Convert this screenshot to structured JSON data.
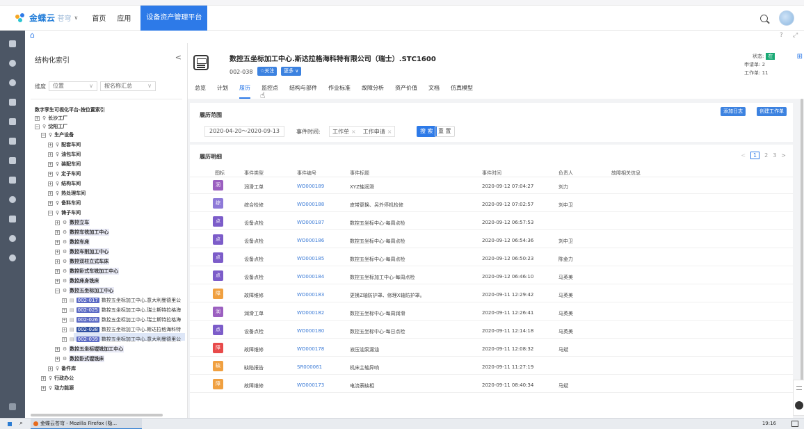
{
  "topbar": {
    "logo": "金蝶云",
    "logo_sub": "苍穹",
    "nav": [
      "首页",
      "应用"
    ],
    "active_nav": "设备资产管理平台"
  },
  "sidepanel": {
    "title": "结构化索引",
    "collapse": "<",
    "dim_label": "维度",
    "dim_value": "位置",
    "summary_value": "按名称汇总",
    "tree": [
      {
        "label": "数字孪生可视化平台-按位置索引"
      },
      {
        "label": "长沙工厂"
      },
      {
        "label": "沈阳工厂"
      },
      {
        "label": "生产设备"
      },
      {
        "label": "配套车间"
      },
      {
        "label": "油包车间"
      },
      {
        "label": "装配车间"
      },
      {
        "label": "定子车间"
      },
      {
        "label": "结构车间"
      },
      {
        "label": "热处理车间"
      },
      {
        "label": "备料车间"
      },
      {
        "label": "铸子车间"
      },
      {
        "label": "数控立车"
      },
      {
        "label": "数控车铣加工中心"
      },
      {
        "label": "数控车床"
      },
      {
        "label": "数控车削加工中心"
      },
      {
        "label": "数控双柱立式车床"
      },
      {
        "label": "数控卧式车铣加工中心"
      },
      {
        "label": "数控床身铣床"
      },
      {
        "label": "数控五坐标加工中心"
      },
      {
        "code": "002-017",
        "label": "数控五坐标加工中心.意大利曼德里公"
      },
      {
        "code": "002-025",
        "label": "数控五坐标加工中心.瑞士斯特拉格海"
      },
      {
        "code": "002-026",
        "label": "数控五坐标加工中心.瑞士斯特拉格海"
      },
      {
        "code": "002-038",
        "label": "数控五坐标加工中心.斯达拉格海科特"
      },
      {
        "code": "002-039",
        "label": "数控五坐标加工中心.意大利曼德里公"
      },
      {
        "label": "数控五坐标镗铣加工中心"
      },
      {
        "label": "数控卧式镗铣床"
      },
      {
        "label": "备件库"
      },
      {
        "label": "行政办公"
      },
      {
        "label": "动力能源"
      }
    ]
  },
  "asset": {
    "title": "数控五坐标加工中心.斯达拉格海科特有限公司（瑞士）.STC1600",
    "code": "002-038",
    "follow_btn": "☆关注",
    "more_btn": "更多 ∨",
    "status_label": "状态:",
    "status_value": "在",
    "request_label": "申请单:",
    "request_value": "2",
    "workorder_label": "工作单:",
    "workorder_value": "11",
    "tabs": [
      "总览",
      "计划",
      "履历",
      "监控点",
      "结构与部件",
      "作业标准",
      "故障分析",
      "资产价值",
      "文档",
      "仿真模型"
    ],
    "active_tab": "履历"
  },
  "scope": {
    "title": "履历范围",
    "add_log_btn": "添加日志",
    "create_wo_btn": "创建工作单",
    "date_range": "2020-04-20～2020-09-13",
    "event_time_label": "事件时间:",
    "tags": [
      "工作单",
      "工作申请"
    ],
    "search_btn": "搜 索",
    "reset_btn": "重 置"
  },
  "detail": {
    "title": "履历明细",
    "pages": [
      "1",
      "2",
      "3"
    ],
    "headers": [
      "图标",
      "事件类型",
      "事件编号",
      "事件标题",
      "事件时间",
      "负责人",
      "故障相关信息"
    ],
    "rows": [
      {
        "icon": "润",
        "color": "#9b5fc0",
        "type": "润滑工单",
        "id": "WO000189",
        "title": "XYZ轴润滑",
        "time": "2020-09-12 07:04:27",
        "owner": "刘力"
      },
      {
        "icon": "综",
        "color": "#8e79d8",
        "type": "综合检修",
        "id": "WO000188",
        "title": "皮带更换、另外停机检修",
        "time": "2020-09-12 07:02:57",
        "owner": "刘中卫"
      },
      {
        "icon": "点",
        "color": "#7c5cc9",
        "type": "设备点检",
        "id": "WO000187",
        "title": "数控五坐标中心-每周点检",
        "time": "2020-09-12 06:57:53",
        "owner": ""
      },
      {
        "icon": "点",
        "color": "#7c5cc9",
        "type": "设备点检",
        "id": "WO000186",
        "title": "数控五坐标中心-每周点检",
        "time": "2020-09-12 06:54:36",
        "owner": "刘中卫"
      },
      {
        "icon": "点",
        "color": "#7c5cc9",
        "type": "设备点检",
        "id": "WO000185",
        "title": "数控五坐标中心-每周点检",
        "time": "2020-09-12 06:50:23",
        "owner": "陈金力"
      },
      {
        "icon": "点",
        "color": "#7c5cc9",
        "type": "设备点检",
        "id": "WO000184",
        "title": "数控五坐标加工中心-每周点检",
        "time": "2020-09-12 06:46:10",
        "owner": "马英美"
      },
      {
        "icon": "障",
        "color": "#f0a040",
        "type": "故障维修",
        "id": "WO000183",
        "title": "更换Z轴防护罩、修理X轴防护罩。",
        "time": "2020-09-11 12:29:42",
        "owner": "马英美"
      },
      {
        "icon": "润",
        "color": "#9b5fc0",
        "type": "润滑工单",
        "id": "WO000182",
        "title": "数控五坐标中心-每周润滑",
        "time": "2020-09-11 12:26:41",
        "owner": "马英美"
      },
      {
        "icon": "点",
        "color": "#7c5cc9",
        "type": "设备点检",
        "id": "WO000180",
        "title": "数控五坐标中心-每日点检",
        "time": "2020-09-11 12:14:18",
        "owner": "马英美"
      },
      {
        "icon": "障",
        "color": "#e84a4a",
        "type": "故障维修",
        "id": "WO000178",
        "title": "液压油泵漏油",
        "time": "2020-09-11 12:08:32",
        "owner": "马斌"
      },
      {
        "icon": "缺",
        "color": "#f0a040",
        "type": "缺陷报告",
        "id": "SR000061",
        "title": "机床主轴异响",
        "time": "2020-09-11 11:27:19",
        "owner": ""
      },
      {
        "icon": "障",
        "color": "#f0a040",
        "type": "故障维修",
        "id": "WO000173",
        "title": "电流表缺相",
        "time": "2020-09-11 08:40:34",
        "owner": "马斌"
      }
    ]
  },
  "taskbar": {
    "app": "金蝶云苍穹 - Mozilla Firefox (隐...",
    "time": "19:16"
  }
}
